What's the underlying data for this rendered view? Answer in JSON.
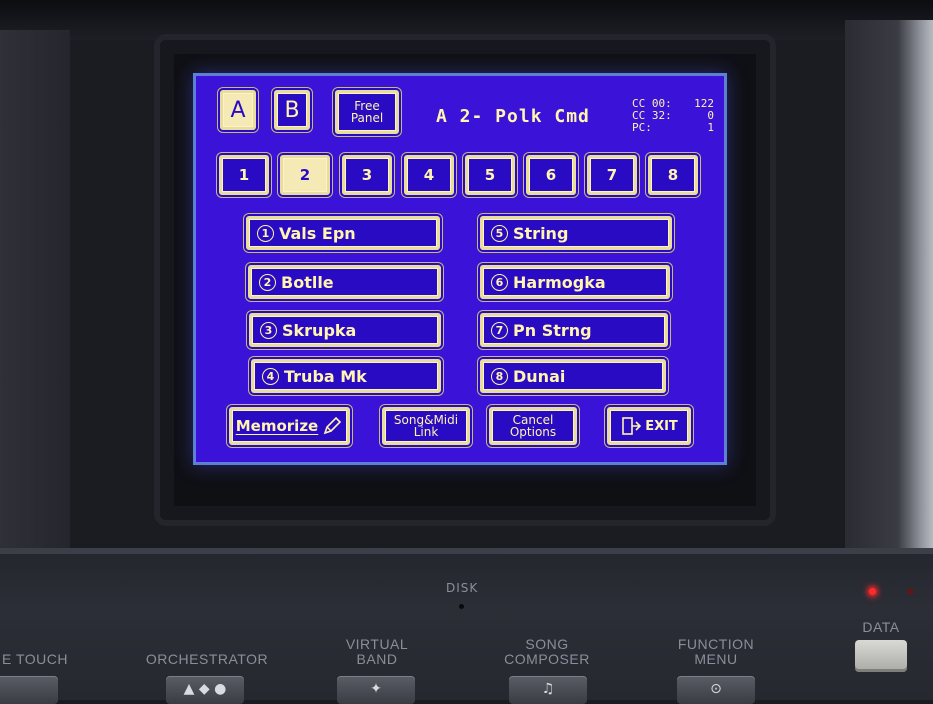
{
  "screen": {
    "bank_tabs": [
      {
        "label": "A",
        "selected": true
      },
      {
        "label": "B",
        "selected": false
      }
    ],
    "free_panel": {
      "line1": "Free",
      "line2": "Panel"
    },
    "title": "A 2-  Polk  Cmd",
    "cc_info": {
      "cc00_label": "CC 00:",
      "cc00_value": "122",
      "cc32_label": "CC 32:",
      "cc32_value": "0",
      "pc_label": "PC:",
      "pc_value": "1"
    },
    "number_tabs": [
      {
        "label": "1",
        "selected": false
      },
      {
        "label": "2",
        "selected": true
      },
      {
        "label": "3",
        "selected": false
      },
      {
        "label": "4",
        "selected": false
      },
      {
        "label": "5",
        "selected": false
      },
      {
        "label": "6",
        "selected": false
      },
      {
        "label": "7",
        "selected": false
      },
      {
        "label": "8",
        "selected": false
      }
    ],
    "voices": [
      {
        "num": "1",
        "name": "Vals  Epn"
      },
      {
        "num": "2",
        "name": "Botlle"
      },
      {
        "num": "3",
        "name": "Skrupka"
      },
      {
        "num": "4",
        "name": "Truba  Mk"
      },
      {
        "num": "5",
        "name": "String"
      },
      {
        "num": "6",
        "name": "Harmogka"
      },
      {
        "num": "7",
        "name": "Pn  Strng"
      },
      {
        "num": "8",
        "name": "Dunai"
      }
    ],
    "bottom": {
      "memorize": "Memorize",
      "song_midi": {
        "line1": "Song&Midi",
        "line2": "Link"
      },
      "cancel": {
        "line1": "Cancel",
        "line2": "Options"
      },
      "exit": "EXIT"
    }
  },
  "hardware": {
    "disk_label": "DISK",
    "touch_label": "E TOUCH",
    "orchestrator_label": "ORCHESTRATOR",
    "virtual_band": {
      "line1": "VIRTUAL",
      "line2": "BAND"
    },
    "song_composer": {
      "line1": "SONG",
      "line2": "COMPOSER"
    },
    "function_menu": {
      "line1": "FUNCTION",
      "line2": "MENU"
    },
    "data_label": "DATA"
  },
  "colors": {
    "lcd_background": "#3a12d8",
    "lcd_text": "#fff4b0",
    "led_red": "#ff2a2a"
  }
}
